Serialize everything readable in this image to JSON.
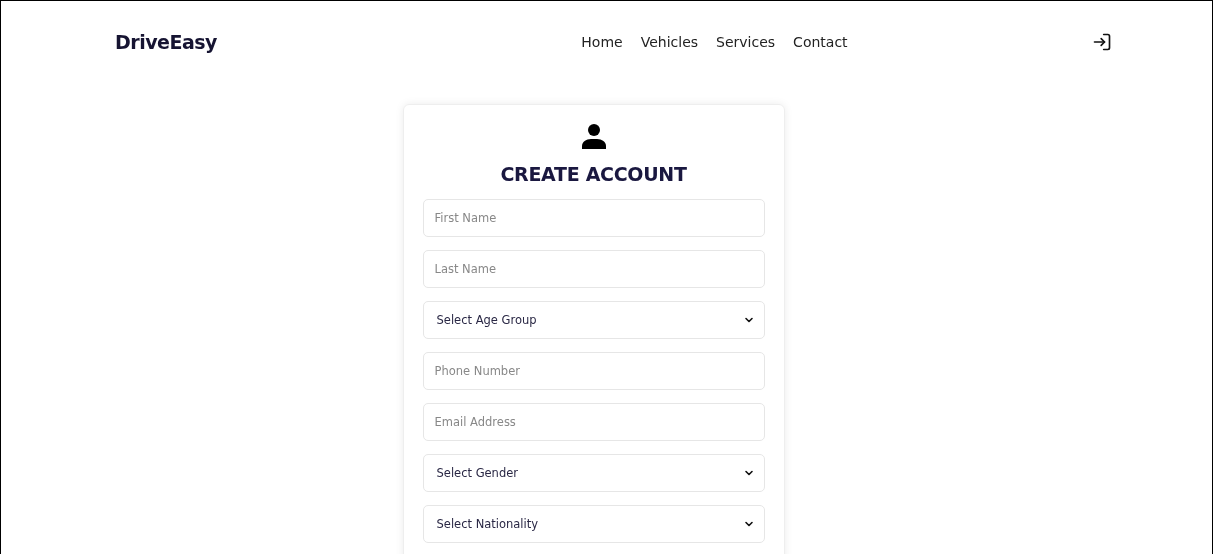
{
  "brand": "DriveEasy",
  "nav": [
    {
      "label": "Home"
    },
    {
      "label": "Vehicles"
    },
    {
      "label": "Services"
    },
    {
      "label": "Contact"
    }
  ],
  "form": {
    "title": "CREATE ACCOUNT",
    "fields": [
      {
        "kind": "text",
        "placeholder": "First Name"
      },
      {
        "kind": "text",
        "placeholder": "Last Name"
      },
      {
        "kind": "select",
        "value": "Select Age Group"
      },
      {
        "kind": "text",
        "placeholder": "Phone Number"
      },
      {
        "kind": "text",
        "placeholder": "Email Address"
      },
      {
        "kind": "select",
        "value": "Select Gender"
      },
      {
        "kind": "select",
        "value": "Select Nationality"
      }
    ]
  }
}
